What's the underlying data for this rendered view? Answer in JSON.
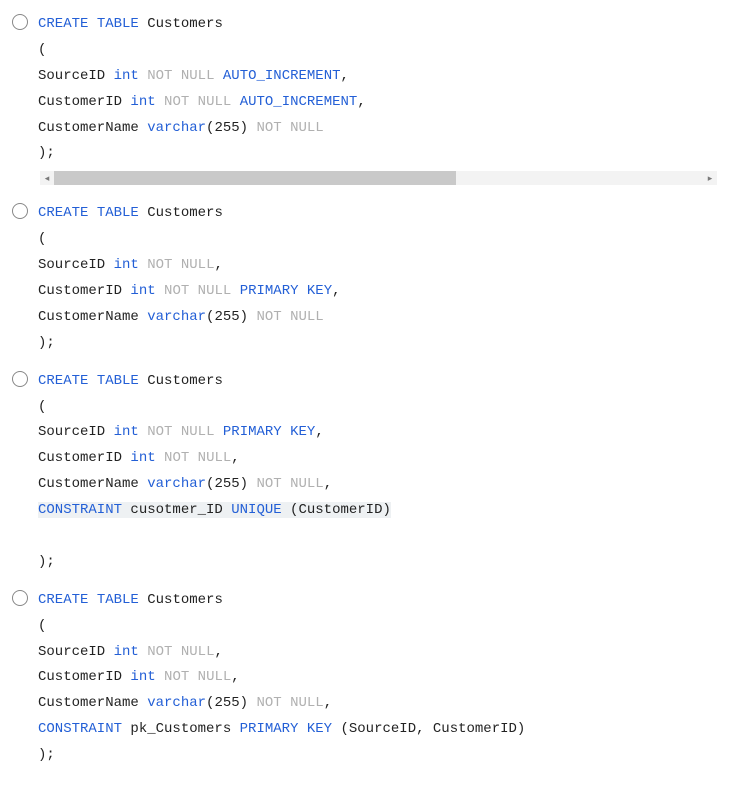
{
  "options": [
    {
      "hasScrollbar": true,
      "lines": [
        [
          {
            "t": "CREATE",
            "c": "kw-blue"
          },
          {
            "t": " ",
            "c": ""
          },
          {
            "t": "TABLE",
            "c": "kw-blue"
          },
          {
            "t": " Customers",
            "c": "kw-black"
          }
        ],
        [
          {
            "t": "(",
            "c": "kw-black"
          }
        ],
        [
          {
            "t": "SourceID ",
            "c": "kw-black"
          },
          {
            "t": "int",
            "c": "kw-blue"
          },
          {
            "t": " ",
            "c": ""
          },
          {
            "t": "NOT",
            "c": "kw-light"
          },
          {
            "t": " ",
            "c": ""
          },
          {
            "t": "NULL",
            "c": "kw-light"
          },
          {
            "t": " ",
            "c": ""
          },
          {
            "t": "AUTO_INCREMENT",
            "c": "kw-blue"
          },
          {
            "t": ",",
            "c": "kw-black"
          }
        ],
        [
          {
            "t": "CustomerID ",
            "c": "kw-black"
          },
          {
            "t": "int",
            "c": "kw-blue"
          },
          {
            "t": " ",
            "c": ""
          },
          {
            "t": "NOT",
            "c": "kw-light"
          },
          {
            "t": " ",
            "c": ""
          },
          {
            "t": "NULL",
            "c": "kw-light"
          },
          {
            "t": " ",
            "c": ""
          },
          {
            "t": "AUTO_INCREMENT",
            "c": "kw-blue"
          },
          {
            "t": ",",
            "c": "kw-black"
          }
        ],
        [
          {
            "t": "CustomerName ",
            "c": "kw-black"
          },
          {
            "t": "varchar",
            "c": "kw-blue"
          },
          {
            "t": "(",
            "c": "kw-black"
          },
          {
            "t": "255",
            "c": "kw-black"
          },
          {
            "t": ") ",
            "c": "kw-black"
          },
          {
            "t": "NOT",
            "c": "kw-light"
          },
          {
            "t": " ",
            "c": ""
          },
          {
            "t": "NULL",
            "c": "kw-light"
          }
        ],
        [
          {
            "t": ");",
            "c": "kw-black"
          }
        ]
      ]
    },
    {
      "hasScrollbar": false,
      "lines": [
        [
          {
            "t": "CREATE",
            "c": "kw-blue"
          },
          {
            "t": " ",
            "c": ""
          },
          {
            "t": "TABLE",
            "c": "kw-blue"
          },
          {
            "t": " Customers",
            "c": "kw-black"
          }
        ],
        [
          {
            "t": "(",
            "c": "kw-black"
          }
        ],
        [
          {
            "t": "SourceID ",
            "c": "kw-black"
          },
          {
            "t": "int",
            "c": "kw-blue"
          },
          {
            "t": " ",
            "c": ""
          },
          {
            "t": "NOT",
            "c": "kw-light"
          },
          {
            "t": " ",
            "c": ""
          },
          {
            "t": "NULL",
            "c": "kw-light"
          },
          {
            "t": ",",
            "c": "kw-black"
          }
        ],
        [
          {
            "t": "CustomerID ",
            "c": "kw-black"
          },
          {
            "t": "int",
            "c": "kw-blue"
          },
          {
            "t": " ",
            "c": ""
          },
          {
            "t": "NOT",
            "c": "kw-light"
          },
          {
            "t": " ",
            "c": ""
          },
          {
            "t": "NULL",
            "c": "kw-light"
          },
          {
            "t": " ",
            "c": ""
          },
          {
            "t": "PRIMARY",
            "c": "kw-blue"
          },
          {
            "t": " ",
            "c": ""
          },
          {
            "t": "KEY",
            "c": "kw-blue"
          },
          {
            "t": ",",
            "c": "kw-black"
          }
        ],
        [
          {
            "t": "CustomerName ",
            "c": "kw-black"
          },
          {
            "t": "varchar",
            "c": "kw-blue"
          },
          {
            "t": "(",
            "c": "kw-black"
          },
          {
            "t": "255",
            "c": "kw-black"
          },
          {
            "t": ") ",
            "c": "kw-black"
          },
          {
            "t": "NOT",
            "c": "kw-light"
          },
          {
            "t": " ",
            "c": ""
          },
          {
            "t": "NULL",
            "c": "kw-light"
          }
        ],
        [
          {
            "t": ");",
            "c": "kw-black"
          }
        ]
      ]
    },
    {
      "hasScrollbar": false,
      "lines": [
        [
          {
            "t": "CREATE",
            "c": "kw-blue"
          },
          {
            "t": " ",
            "c": ""
          },
          {
            "t": "TABLE",
            "c": "kw-blue"
          },
          {
            "t": " Customers",
            "c": "kw-black"
          }
        ],
        [
          {
            "t": "(",
            "c": "kw-black"
          }
        ],
        [
          {
            "t": "SourceID ",
            "c": "kw-black"
          },
          {
            "t": "int",
            "c": "kw-blue"
          },
          {
            "t": " ",
            "c": ""
          },
          {
            "t": "NOT",
            "c": "kw-light"
          },
          {
            "t": " ",
            "c": ""
          },
          {
            "t": "NULL",
            "c": "kw-light"
          },
          {
            "t": " ",
            "c": ""
          },
          {
            "t": "PRIMARY",
            "c": "kw-blue"
          },
          {
            "t": " ",
            "c": ""
          },
          {
            "t": "KEY",
            "c": "kw-blue"
          },
          {
            "t": ",",
            "c": "kw-black"
          }
        ],
        [
          {
            "t": "CustomerID ",
            "c": "kw-black"
          },
          {
            "t": "int",
            "c": "kw-blue"
          },
          {
            "t": " ",
            "c": ""
          },
          {
            "t": "NOT",
            "c": "kw-light"
          },
          {
            "t": " ",
            "c": ""
          },
          {
            "t": "NULL",
            "c": "kw-light"
          },
          {
            "t": ",",
            "c": "kw-black"
          }
        ],
        [
          {
            "t": "CustomerName ",
            "c": "kw-black"
          },
          {
            "t": "varchar",
            "c": "kw-blue"
          },
          {
            "t": "(",
            "c": "kw-black"
          },
          {
            "t": "255",
            "c": "kw-black"
          },
          {
            "t": ") ",
            "c": "kw-black"
          },
          {
            "t": "NOT",
            "c": "kw-light"
          },
          {
            "t": " ",
            "c": ""
          },
          {
            "t": "NULL",
            "c": "kw-light"
          },
          {
            "t": ",",
            "c": "kw-black"
          }
        ],
        [
          {
            "t": "CONSTRAINT",
            "c": "kw-blue",
            "hl": true
          },
          {
            "t": " cusotmer_ID ",
            "c": "kw-black",
            "hl": true
          },
          {
            "t": "UNIQUE",
            "c": "kw-blue",
            "hl": true
          },
          {
            "t": " (CustomerID)",
            "c": "kw-black",
            "hl": true
          }
        ],
        [
          {
            "t": " ",
            "c": ""
          }
        ],
        [
          {
            "t": ");",
            "c": "kw-black"
          }
        ]
      ]
    },
    {
      "hasScrollbar": false,
      "lines": [
        [
          {
            "t": "CREATE",
            "c": "kw-blue"
          },
          {
            "t": " ",
            "c": ""
          },
          {
            "t": "TABLE",
            "c": "kw-blue"
          },
          {
            "t": " Customers",
            "c": "kw-black"
          }
        ],
        [
          {
            "t": "(",
            "c": "kw-black"
          }
        ],
        [
          {
            "t": "SourceID ",
            "c": "kw-black"
          },
          {
            "t": "int",
            "c": "kw-blue"
          },
          {
            "t": " ",
            "c": ""
          },
          {
            "t": "NOT",
            "c": "kw-light"
          },
          {
            "t": " ",
            "c": ""
          },
          {
            "t": "NULL",
            "c": "kw-light"
          },
          {
            "t": ",",
            "c": "kw-black"
          }
        ],
        [
          {
            "t": "CustomerID ",
            "c": "kw-black"
          },
          {
            "t": "int",
            "c": "kw-blue"
          },
          {
            "t": " ",
            "c": ""
          },
          {
            "t": "NOT",
            "c": "kw-light"
          },
          {
            "t": " ",
            "c": ""
          },
          {
            "t": "NULL",
            "c": "kw-light"
          },
          {
            "t": ",",
            "c": "kw-black"
          }
        ],
        [
          {
            "t": "CustomerName ",
            "c": "kw-black"
          },
          {
            "t": "varchar",
            "c": "kw-blue"
          },
          {
            "t": "(",
            "c": "kw-black"
          },
          {
            "t": "255",
            "c": "kw-black"
          },
          {
            "t": ") ",
            "c": "kw-black"
          },
          {
            "t": "NOT",
            "c": "kw-light"
          },
          {
            "t": " ",
            "c": ""
          },
          {
            "t": "NULL",
            "c": "kw-light"
          },
          {
            "t": ",",
            "c": "kw-black"
          }
        ],
        [
          {
            "t": "CONSTRAINT",
            "c": "kw-blue"
          },
          {
            "t": " pk_Customers ",
            "c": "kw-black"
          },
          {
            "t": "PRIMARY",
            "c": "kw-blue"
          },
          {
            "t": " ",
            "c": ""
          },
          {
            "t": "KEY",
            "c": "kw-blue"
          },
          {
            "t": " (SourceID, CustomerID)",
            "c": "kw-black"
          }
        ],
        [
          {
            "t": ");",
            "c": "kw-black"
          }
        ]
      ]
    }
  ],
  "scrollbar": {
    "left_arrow": "◂",
    "right_arrow": "▸"
  }
}
